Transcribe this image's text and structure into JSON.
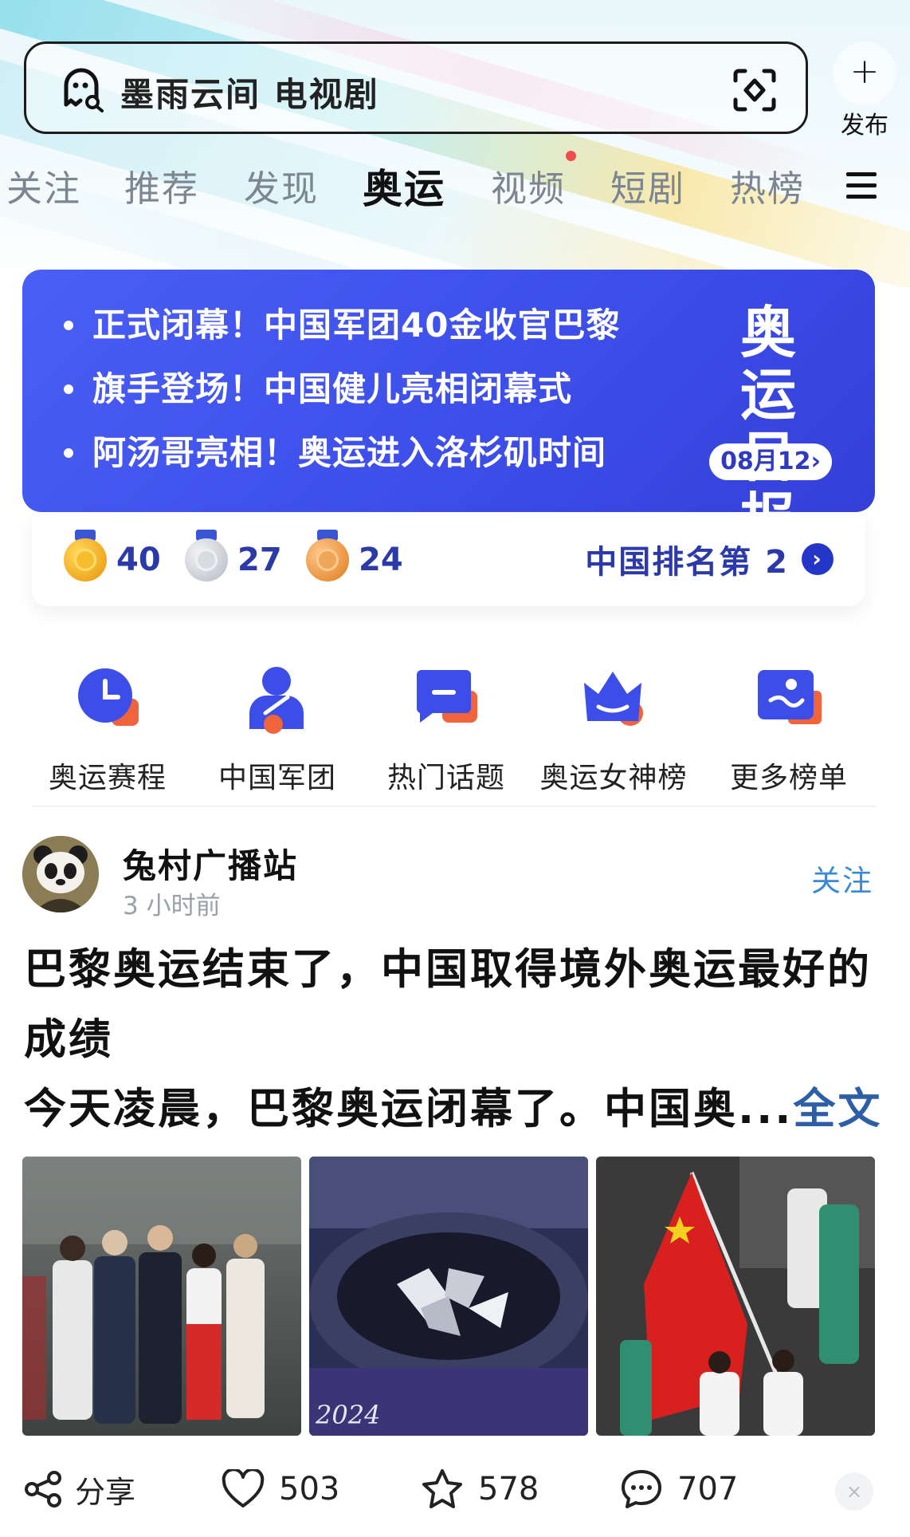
{
  "search": {
    "placeholder": "墨雨云间 电视剧"
  },
  "publish": {
    "label": "发布"
  },
  "tabs": [
    {
      "label": "关注"
    },
    {
      "label": "推荐"
    },
    {
      "label": "发现"
    },
    {
      "label": "奥运"
    },
    {
      "label": "视频"
    },
    {
      "label": "短剧"
    },
    {
      "label": "热榜"
    }
  ],
  "banner": {
    "headlines": [
      "正式闭幕！中国军团40金收官巴黎",
      "旗手登场！中国健儿亮相闭幕式",
      "阿汤哥亮相！奥运进入洛杉矶时间"
    ],
    "title_line1": "奥运",
    "title_line2": "日报",
    "date": "08月12",
    "date_arrow": "›"
  },
  "medals": {
    "gold": "40",
    "silver": "27",
    "bronze": "24",
    "rank_text": "中国排名第 2",
    "rank_arrow": "›"
  },
  "entries": [
    {
      "label": "奥运赛程"
    },
    {
      "label": "中国军团"
    },
    {
      "label": "热门话题"
    },
    {
      "label": "奥运女神榜"
    },
    {
      "label": "更多榜单"
    }
  ],
  "post": {
    "author": "兔村广播站",
    "time": "3 小时前",
    "follow": "关注",
    "title": "巴黎奥运结束了，中国取得境外奥运最好的成绩",
    "excerpt": "今天凌晨，巴黎奥运闭幕了。中国奥...",
    "more": "全文",
    "photo_caption": "2024"
  },
  "actions": {
    "share": "分享",
    "likes": "503",
    "favorites": "578",
    "comments": "707",
    "close": "×"
  },
  "colors": {
    "brand_blue": "#3c4de8",
    "link_blue": "#3a88d8",
    "dot_red": "#f24b4b"
  }
}
